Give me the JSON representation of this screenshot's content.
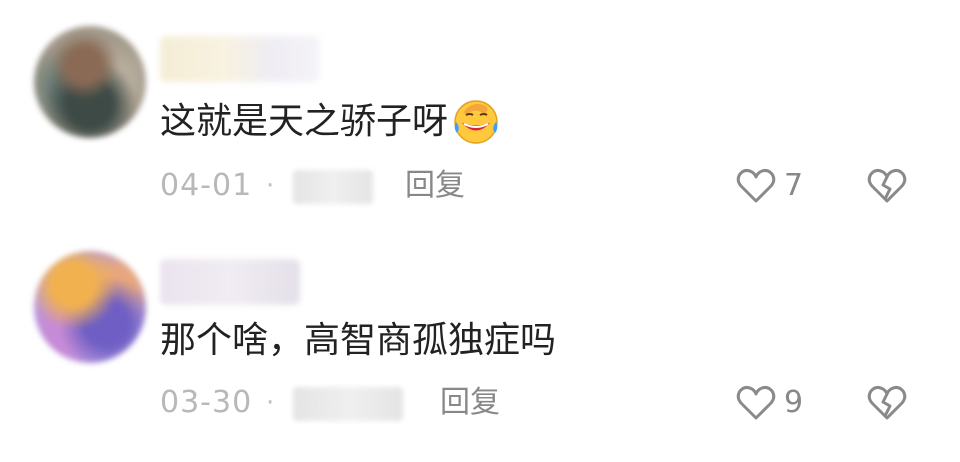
{
  "comments": [
    {
      "content": "这就是天之骄子呀",
      "emoji": "laughing-crying-emoji",
      "date": "04-01",
      "separator": "·",
      "reply_label": "回复",
      "like_count": "7"
    },
    {
      "content": "那个啥，高智商孤独症吗",
      "date": "03-30",
      "separator": "·",
      "reply_label": "回复",
      "like_count": "9"
    }
  ],
  "colors": {
    "text": "#222222",
    "meta": "#b8b8b8",
    "action": "#888888"
  },
  "icons": {
    "like": "heart-outline-icon",
    "dislike": "broken-heart-icon"
  }
}
